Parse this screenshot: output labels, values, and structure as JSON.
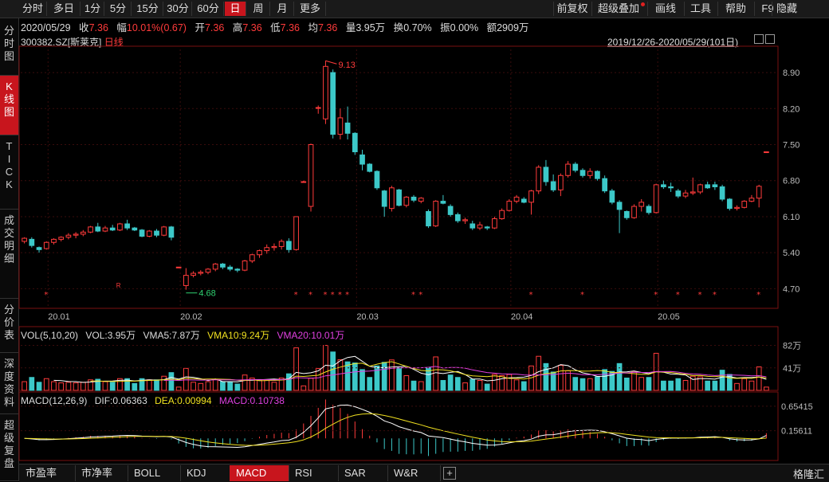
{
  "toolbar": {
    "periods": [
      "分时",
      "多日",
      "1分",
      "5分",
      "15分",
      "30分",
      "60分",
      "日",
      "周",
      "月",
      "更多"
    ],
    "active_period": "日",
    "right_items": [
      "前复权",
      "超级叠加",
      "画线",
      "工具",
      "帮助",
      "F9",
      "隐藏"
    ]
  },
  "sidebar": [
    {
      "label": "分时图",
      "active": false
    },
    {
      "label": "K线图",
      "active": true
    },
    {
      "label": "TICK",
      "active": false
    },
    {
      "label": "成交明细",
      "active": false
    },
    {
      "label": "分价表",
      "active": false
    },
    {
      "label": "深度资料",
      "active": false
    },
    {
      "label": "超级复盘",
      "active": false
    }
  ],
  "quote": {
    "date": "2020/05/29",
    "close_label": "收",
    "close": "7.36",
    "change_label": "幅",
    "change": "10.01%(0.67)",
    "open_label": "开",
    "open": "7.36",
    "high_label": "高",
    "high": "7.36",
    "low_label": "低",
    "low": "7.36",
    "avg_label": "均",
    "avg": "7.36",
    "volume_label": "量",
    "volume": "3.95万",
    "turnover_label": "换",
    "turnover": "0.70%",
    "amplitude_label": "振",
    "amplitude": "0.00%",
    "amount_label": "额",
    "amount": "2909万"
  },
  "stock": {
    "code": "300382.SZ",
    "name": "[斯莱克]",
    "period_label": "日线"
  },
  "range_label": "2019/12/26-2020/05/29(101日)",
  "price_axis": {
    "ticks": [
      "8.90",
      "8.20",
      "7.50",
      "6.80",
      "6.10",
      "5.40",
      "4.70"
    ],
    "values": [
      8.9,
      8.2,
      7.5,
      6.8,
      6.1,
      5.4,
      4.7
    ]
  },
  "date_axis": {
    "ticks": [
      "20.01",
      "20.02",
      "20.03",
      "20.04",
      "20.05"
    ]
  },
  "annotations": {
    "high": "9.13",
    "low": "4.68"
  },
  "volume_panel": {
    "title": "VOL(5,10,20)",
    "vol": "VOL:3.95万",
    "vma5": "VMA5:7.87万",
    "vma10": "VMA10:9.24万",
    "vma20": "VMA20:10.01万",
    "ticks": [
      "82万",
      "41万"
    ]
  },
  "macd_panel": {
    "title": "MACD(12,26,9)",
    "dif": "DIF:0.06363",
    "dea": "DEA:0.00994",
    "macd": "MACD:0.10738",
    "ticks": [
      "0.65415",
      "0.15611"
    ]
  },
  "bottom_tabs": [
    "市盈率",
    "市净率",
    "BOLL",
    "KDJ",
    "MACD",
    "RSI",
    "SAR",
    "W&R"
  ],
  "active_tab": "MACD",
  "brand": "格隆汇",
  "colors": {
    "up": "#ff3b3b",
    "down": "#3cc8c8",
    "active": "#c8151d",
    "vma5": "#ffffff",
    "vma10": "#f0e020",
    "vma20": "#e040e0"
  },
  "chart_data": {
    "type": "candlestick",
    "title": "300382.SZ [斯莱克] 日线",
    "candles": [
      {
        "o": 5.62,
        "h": 5.7,
        "l": 5.58,
        "c": 5.68
      },
      {
        "o": 5.66,
        "h": 5.7,
        "l": 5.5,
        "c": 5.54
      },
      {
        "o": 5.5,
        "h": 5.52,
        "l": 5.4,
        "c": 5.46
      },
      {
        "o": 5.48,
        "h": 5.62,
        "l": 5.46,
        "c": 5.6
      },
      {
        "o": 5.6,
        "h": 5.68,
        "l": 5.56,
        "c": 5.66
      },
      {
        "o": 5.66,
        "h": 5.72,
        "l": 5.62,
        "c": 5.7
      },
      {
        "o": 5.7,
        "h": 5.78,
        "l": 5.66,
        "c": 5.74
      },
      {
        "o": 5.74,
        "h": 5.8,
        "l": 5.68,
        "c": 5.76
      },
      {
        "o": 5.76,
        "h": 5.84,
        "l": 5.72,
        "c": 5.8
      },
      {
        "o": 5.8,
        "h": 5.92,
        "l": 5.78,
        "c": 5.9
      },
      {
        "o": 5.9,
        "h": 5.98,
        "l": 5.8,
        "c": 5.82
      },
      {
        "o": 5.82,
        "h": 5.92,
        "l": 5.8,
        "c": 5.88
      },
      {
        "o": 5.88,
        "h": 5.94,
        "l": 5.82,
        "c": 5.84
      },
      {
        "o": 5.84,
        "h": 5.98,
        "l": 5.82,
        "c": 5.96
      },
      {
        "o": 5.96,
        "h": 6.04,
        "l": 5.84,
        "c": 5.88
      },
      {
        "o": 5.88,
        "h": 5.9,
        "l": 5.82,
        "c": 5.84
      },
      {
        "o": 5.84,
        "h": 5.86,
        "l": 5.7,
        "c": 5.72
      },
      {
        "o": 5.72,
        "h": 5.84,
        "l": 5.7,
        "c": 5.82
      },
      {
        "o": 5.82,
        "h": 5.86,
        "l": 5.7,
        "c": 5.74
      },
      {
        "o": 5.74,
        "h": 5.92,
        "l": 5.72,
        "c": 5.9
      },
      {
        "o": 5.9,
        "h": 5.92,
        "l": 5.64,
        "c": 5.7
      },
      {
        "o": 5.12,
        "h": 5.12,
        "l": 5.12,
        "c": 5.12
      },
      {
        "o": 4.76,
        "h": 5.1,
        "l": 4.68,
        "c": 4.96
      },
      {
        "o": 4.96,
        "h": 5.04,
        "l": 4.92,
        "c": 5.0
      },
      {
        "o": 5.0,
        "h": 5.06,
        "l": 4.96,
        "c": 5.02
      },
      {
        "o": 5.02,
        "h": 5.1,
        "l": 4.98,
        "c": 5.08
      },
      {
        "o": 5.08,
        "h": 5.2,
        "l": 5.04,
        "c": 5.18
      },
      {
        "o": 5.18,
        "h": 5.2,
        "l": 5.08,
        "c": 5.12
      },
      {
        "o": 5.12,
        "h": 5.16,
        "l": 5.04,
        "c": 5.08
      },
      {
        "o": 5.08,
        "h": 5.1,
        "l": 5.02,
        "c": 5.06
      },
      {
        "o": 5.06,
        "h": 5.26,
        "l": 5.04,
        "c": 5.24
      },
      {
        "o": 5.24,
        "h": 5.38,
        "l": 5.2,
        "c": 5.36
      },
      {
        "o": 5.36,
        "h": 5.46,
        "l": 5.3,
        "c": 5.44
      },
      {
        "o": 5.44,
        "h": 5.56,
        "l": 5.38,
        "c": 5.5
      },
      {
        "o": 5.5,
        "h": 5.58,
        "l": 5.44,
        "c": 5.52
      },
      {
        "o": 5.52,
        "h": 5.66,
        "l": 5.46,
        "c": 5.62
      },
      {
        "o": 5.62,
        "h": 5.68,
        "l": 5.4,
        "c": 5.46
      },
      {
        "o": 5.46,
        "h": 6.1,
        "l": 5.44,
        "c": 6.1
      },
      {
        "o": 6.78,
        "h": 6.8,
        "l": 6.76,
        "c": 6.78
      },
      {
        "o": 6.3,
        "h": 7.52,
        "l": 6.2,
        "c": 7.5
      },
      {
        "o": 8.22,
        "h": 8.26,
        "l": 8.1,
        "c": 8.22
      },
      {
        "o": 8.0,
        "h": 9.13,
        "l": 7.9,
        "c": 9.02
      },
      {
        "o": 8.9,
        "h": 8.96,
        "l": 7.62,
        "c": 7.7
      },
      {
        "o": 7.7,
        "h": 8.2,
        "l": 7.6,
        "c": 8.02
      },
      {
        "o": 7.92,
        "h": 8.24,
        "l": 7.6,
        "c": 7.72
      },
      {
        "o": 7.72,
        "h": 7.74,
        "l": 7.3,
        "c": 7.36
      },
      {
        "o": 7.3,
        "h": 7.4,
        "l": 7.0,
        "c": 7.12
      },
      {
        "o": 7.12,
        "h": 7.14,
        "l": 6.96,
        "c": 6.98
      },
      {
        "o": 6.98,
        "h": 7.0,
        "l": 6.62,
        "c": 6.66
      },
      {
        "o": 6.6,
        "h": 6.62,
        "l": 6.1,
        "c": 6.3
      },
      {
        "o": 6.26,
        "h": 6.7,
        "l": 6.2,
        "c": 6.66
      },
      {
        "o": 6.62,
        "h": 6.64,
        "l": 6.3,
        "c": 6.32
      },
      {
        "o": 6.32,
        "h": 6.5,
        "l": 6.28,
        "c": 6.48
      },
      {
        "o": 6.48,
        "h": 6.52,
        "l": 6.38,
        "c": 6.42
      },
      {
        "o": 6.4,
        "h": 6.48,
        "l": 6.36,
        "c": 6.46
      },
      {
        "o": 6.2,
        "h": 6.24,
        "l": 5.88,
        "c": 5.92
      },
      {
        "o": 5.92,
        "h": 6.42,
        "l": 5.9,
        "c": 6.4
      },
      {
        "o": 6.4,
        "h": 6.52,
        "l": 6.34,
        "c": 6.36
      },
      {
        "o": 6.3,
        "h": 6.34,
        "l": 6.1,
        "c": 6.14
      },
      {
        "o": 6.14,
        "h": 6.18,
        "l": 5.98,
        "c": 6.02
      },
      {
        "o": 6.02,
        "h": 6.08,
        "l": 5.96,
        "c": 6.04
      },
      {
        "o": 5.96,
        "h": 6.02,
        "l": 5.84,
        "c": 5.88
      },
      {
        "o": 5.88,
        "h": 6.0,
        "l": 5.84,
        "c": 5.94
      },
      {
        "o": 5.9,
        "h": 5.92,
        "l": 5.84,
        "c": 5.88
      },
      {
        "o": 5.88,
        "h": 6.1,
        "l": 5.86,
        "c": 6.06
      },
      {
        "o": 6.06,
        "h": 6.26,
        "l": 6.04,
        "c": 6.22
      },
      {
        "o": 6.22,
        "h": 6.44,
        "l": 6.2,
        "c": 6.4
      },
      {
        "o": 6.4,
        "h": 6.52,
        "l": 6.36,
        "c": 6.48
      },
      {
        "o": 6.44,
        "h": 6.48,
        "l": 6.36,
        "c": 6.38
      },
      {
        "o": 6.38,
        "h": 6.62,
        "l": 6.14,
        "c": 6.6
      },
      {
        "o": 6.6,
        "h": 7.1,
        "l": 6.54,
        "c": 7.06
      },
      {
        "o": 7.06,
        "h": 7.2,
        "l": 6.7,
        "c": 6.78
      },
      {
        "o": 6.78,
        "h": 6.92,
        "l": 6.58,
        "c": 6.62
      },
      {
        "o": 6.62,
        "h": 6.94,
        "l": 6.5,
        "c": 6.9
      },
      {
        "o": 6.9,
        "h": 7.18,
        "l": 6.86,
        "c": 7.12
      },
      {
        "o": 7.12,
        "h": 7.16,
        "l": 6.96,
        "c": 7.0
      },
      {
        "o": 7.0,
        "h": 7.04,
        "l": 6.86,
        "c": 6.9
      },
      {
        "o": 6.9,
        "h": 7.04,
        "l": 6.84,
        "c": 6.98
      },
      {
        "o": 6.98,
        "h": 7.0,
        "l": 6.8,
        "c": 6.84
      },
      {
        "o": 6.84,
        "h": 6.9,
        "l": 6.56,
        "c": 6.6
      },
      {
        "o": 6.6,
        "h": 6.64,
        "l": 6.34,
        "c": 6.38
      },
      {
        "o": 6.38,
        "h": 6.42,
        "l": 5.78,
        "c": 6.24
      },
      {
        "o": 6.2,
        "h": 6.22,
        "l": 6.04,
        "c": 6.08
      },
      {
        "o": 6.08,
        "h": 6.34,
        "l": 6.06,
        "c": 6.3
      },
      {
        "o": 6.3,
        "h": 6.44,
        "l": 6.2,
        "c": 6.38
      },
      {
        "o": 6.3,
        "h": 6.34,
        "l": 6.14,
        "c": 6.18
      },
      {
        "o": 6.18,
        "h": 6.74,
        "l": 6.16,
        "c": 6.72
      },
      {
        "o": 6.72,
        "h": 6.8,
        "l": 6.64,
        "c": 6.68
      },
      {
        "o": 6.68,
        "h": 6.76,
        "l": 6.58,
        "c": 6.66
      },
      {
        "o": 6.6,
        "h": 6.64,
        "l": 6.46,
        "c": 6.5
      },
      {
        "o": 6.5,
        "h": 6.62,
        "l": 6.46,
        "c": 6.56
      },
      {
        "o": 6.56,
        "h": 6.86,
        "l": 6.52,
        "c": 6.58
      },
      {
        "o": 6.58,
        "h": 6.74,
        "l": 6.54,
        "c": 6.72
      },
      {
        "o": 6.72,
        "h": 6.78,
        "l": 6.64,
        "c": 6.66
      },
      {
        "o": 6.72,
        "h": 6.78,
        "l": 6.62,
        "c": 6.68
      },
      {
        "o": 6.68,
        "h": 6.72,
        "l": 6.4,
        "c": 6.44
      },
      {
        "o": 6.44,
        "h": 6.46,
        "l": 6.22,
        "c": 6.26
      },
      {
        "o": 6.26,
        "h": 6.32,
        "l": 6.22,
        "c": 6.28
      },
      {
        "o": 6.28,
        "h": 6.42,
        "l": 6.26,
        "c": 6.4
      },
      {
        "o": 6.4,
        "h": 6.52,
        "l": 6.38,
        "c": 6.46
      },
      {
        "o": 6.46,
        "h": 6.72,
        "l": 6.28,
        "c": 6.69
      },
      {
        "o": 7.36,
        "h": 7.36,
        "l": 7.36,
        "c": 7.36
      }
    ],
    "price_range": [
      4.35,
      9.35
    ],
    "volume_range": [
      0,
      90
    ],
    "macd_range": [
      -0.45,
      0.75
    ]
  }
}
